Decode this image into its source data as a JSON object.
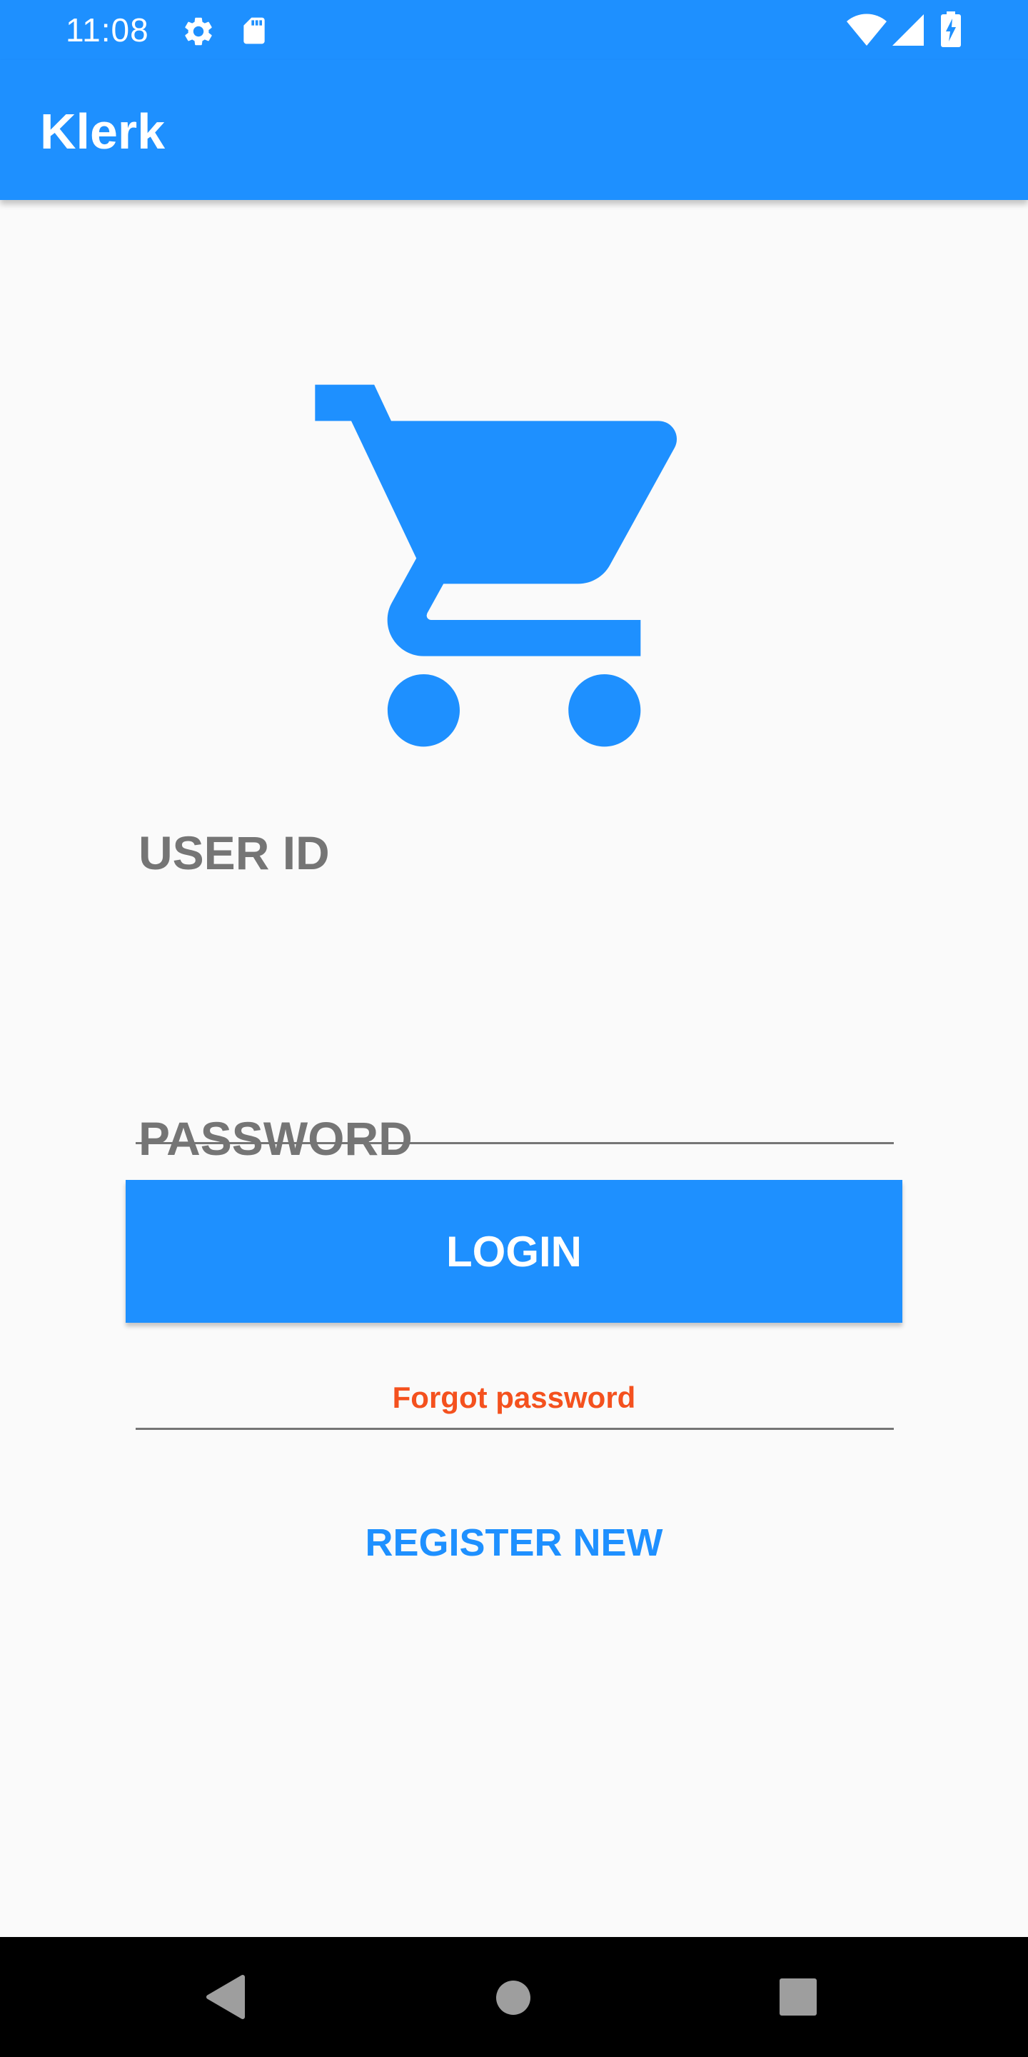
{
  "status_bar": {
    "time": "11:08",
    "icons": [
      "gear-icon",
      "sd-card-icon",
      "wifi-icon",
      "cell-signal-icon",
      "battery-charging-icon"
    ]
  },
  "app_bar": {
    "title": "Klerk"
  },
  "login_form": {
    "logo_icon": "shopping-cart-icon",
    "user_id_label": "USER ID",
    "user_id_value": "",
    "password_label": "PASSWORD",
    "password_value": "",
    "login_button_label": "LOGIN",
    "forgot_password_label": "Forgot password",
    "register_label": "REGISTER NEW"
  },
  "nav_bar": {
    "buttons": [
      "back-icon",
      "home-icon",
      "recents-icon"
    ]
  },
  "colors": {
    "primary": "#1e90ff",
    "accent": "#f4511e",
    "label_gray": "#757575",
    "background": "#fafafa"
  }
}
